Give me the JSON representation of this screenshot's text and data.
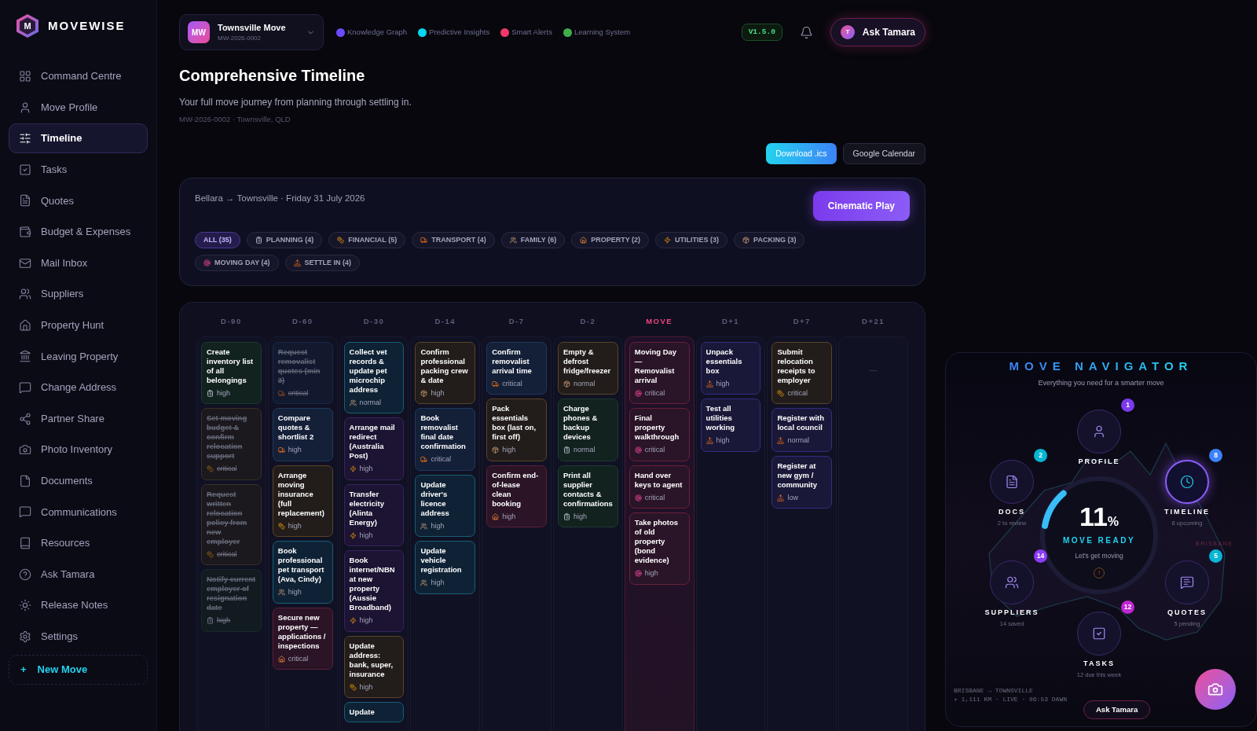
{
  "brand": {
    "logo_letter": "M",
    "name": "MOVEWISE"
  },
  "sidebar": {
    "items": [
      {
        "label": "Command Centre",
        "selected": false
      },
      {
        "label": "Move Profile",
        "selected": false
      },
      {
        "label": "Timeline",
        "selected": true
      },
      {
        "label": "Tasks",
        "selected": false
      },
      {
        "label": "Quotes",
        "selected": false
      },
      {
        "label": "Budget & Expenses",
        "selected": false
      },
      {
        "label": "Mail Inbox",
        "selected": false
      },
      {
        "label": "Suppliers",
        "selected": false
      },
      {
        "label": "Property Hunt",
        "selected": false
      },
      {
        "label": "Leaving Property",
        "selected": false
      },
      {
        "label": "Change Address",
        "selected": false
      },
      {
        "label": "Partner Share",
        "selected": false
      },
      {
        "label": "Photo Inventory",
        "selected": false
      },
      {
        "label": "Documents",
        "selected": false
      },
      {
        "label": "Communications",
        "selected": false
      },
      {
        "label": "Resources",
        "selected": false
      },
      {
        "label": "Ask Tamara",
        "selected": false
      },
      {
        "label": "Release Notes",
        "selected": false
      },
      {
        "label": "Settings",
        "selected": false
      }
    ],
    "new_button": {
      "icon": "+",
      "label": "New Move"
    }
  },
  "topbar": {
    "project": {
      "initials": "MW",
      "name": "Townsville Move",
      "id": "MW-2026-0002"
    },
    "systems": [
      {
        "label": "Knowledge Graph",
        "color": "#6d4aff"
      },
      {
        "label": "Predictive Insights",
        "color": "#06d6f0"
      },
      {
        "label": "Smart Alerts",
        "color": "#f0386b"
      },
      {
        "label": "Learning System",
        "color": "#3fae4a"
      }
    ],
    "version": "V1.5.0",
    "assistant": {
      "initial": "T",
      "label": "Ask Tamara"
    }
  },
  "page": {
    "title": "Comprehensive Timeline",
    "subtitle": "Your full move journey from planning through settling in.",
    "meta": "MW-2026-0002 · Townsville, QLD",
    "actions": [
      {
        "label": "Download .ics",
        "kind": "primary"
      },
      {
        "label": "Google Calendar",
        "kind": "secondary"
      }
    ]
  },
  "filters": {
    "route": "Bellara → Townsville · Friday 31 July 2026",
    "play_button": "Cinematic Play",
    "chips": [
      {
        "label": "ALL (35)",
        "kind": "all",
        "selected": true
      },
      {
        "label": "PLANNING (4)",
        "kind": "planning",
        "selected": false
      },
      {
        "label": "FINANCIAL (5)",
        "kind": "financial",
        "selected": false
      },
      {
        "label": "TRANSPORT (4)",
        "kind": "transport",
        "selected": false
      },
      {
        "label": "FAMILY (6)",
        "kind": "family",
        "selected": false
      },
      {
        "label": "PROPERTY (2)",
        "kind": "property",
        "selected": false
      },
      {
        "label": "UTILITIES (3)",
        "kind": "utilities",
        "selected": false
      },
      {
        "label": "PACKING (3)",
        "kind": "packing",
        "selected": false
      },
      {
        "label": "MOVING DAY (4)",
        "kind": "moving_day",
        "selected": false
      },
      {
        "label": "SETTLE IN (4)",
        "kind": "settle_in",
        "selected": false
      }
    ]
  },
  "timeline": {
    "columns": [
      {
        "label": "D-90",
        "current": false,
        "tasks": [
          {
            "title": "Create inventory list of all belongings",
            "kind": "planning",
            "priority": "high",
            "done": false
          },
          {
            "title": "Set moving budget & confirm relocation support",
            "kind": "financial",
            "priority": "critical",
            "done": true
          },
          {
            "title": "Request written relocation policy from new employer",
            "kind": "financial",
            "priority": "critical",
            "done": true
          },
          {
            "title": "Notify current employer of resignation date",
            "kind": "planning",
            "priority": "high",
            "done": true
          }
        ]
      },
      {
        "label": "D-60",
        "current": false,
        "tasks": [
          {
            "title": "Request removalist quotes (min 3)",
            "kind": "transport",
            "priority": "critical",
            "done": true
          },
          {
            "title": "Compare quotes & shortlist 2",
            "kind": "transport",
            "priority": "high",
            "done": false
          },
          {
            "title": "Arrange moving insurance (full replacement)",
            "kind": "financial",
            "priority": "high",
            "done": false
          },
          {
            "title": "Book professional pet transport (Ava, Cindy)",
            "kind": "family",
            "priority": "high",
            "done": false
          },
          {
            "title": "Secure new property — applications / inspections",
            "kind": "property",
            "priority": "critical",
            "done": false
          }
        ]
      },
      {
        "label": "D-30",
        "current": false,
        "tasks": [
          {
            "title": "Collect vet records & update pet microchip address",
            "kind": "family",
            "priority": "normal",
            "done": false
          },
          {
            "title": "Arrange mail redirect (Australia Post)",
            "kind": "utilities",
            "priority": "high",
            "done": false
          },
          {
            "title": "Transfer electricity (Alinta Energy)",
            "kind": "utilities",
            "priority": "high",
            "done": false
          },
          {
            "title": "Book internet/NBN at new property (Aussie Broadband)",
            "kind": "utilities",
            "priority": "high",
            "done": false
          },
          {
            "title": "Update address: bank, super, insurance",
            "kind": "financial",
            "priority": "high",
            "done": false
          },
          {
            "title": "Update",
            "kind": "family",
            "done": false
          }
        ]
      },
      {
        "label": "D-14",
        "current": false,
        "tasks": [
          {
            "title": "Confirm professional packing crew & date",
            "kind": "packing",
            "priority": "high",
            "done": false
          },
          {
            "title": "Book removalist final date confirmation",
            "kind": "transport",
            "priority": "critical",
            "done": false
          },
          {
            "title": "Update driver's licence address",
            "kind": "family",
            "priority": "high",
            "done": false
          },
          {
            "title": "Update vehicle registration",
            "kind": "family",
            "priority": "high",
            "done": false
          }
        ]
      },
      {
        "label": "D-7",
        "current": false,
        "tasks": [
          {
            "title": "Confirm removalist arrival time",
            "kind": "transport",
            "priority": "critical",
            "done": false
          },
          {
            "title": "Pack essentials box (last on, first off)",
            "kind": "packing",
            "priority": "high",
            "done": false
          },
          {
            "title": "Confirm end-of-lease clean booking",
            "kind": "property",
            "priority": "high",
            "done": false
          }
        ]
      },
      {
        "label": "D-2",
        "current": false,
        "tasks": [
          {
            "title": "Empty & defrost fridge/freezer",
            "kind": "packing",
            "priority": "normal",
            "done": false
          },
          {
            "title": "Charge phones & backup devices",
            "kind": "planning",
            "priority": "normal",
            "done": false
          },
          {
            "title": "Print all supplier contacts & confirmations",
            "kind": "planning",
            "priority": "high",
            "done": false
          }
        ]
      },
      {
        "label": "MOVE",
        "current": true,
        "tasks": [
          {
            "title": "Moving Day — Removalist arrival",
            "kind": "moving_day",
            "priority": "critical",
            "done": false
          },
          {
            "title": "Final property walkthrough",
            "kind": "moving_day",
            "priority": "critical",
            "done": false
          },
          {
            "title": "Hand over keys to agent",
            "kind": "moving_day",
            "priority": "critical",
            "done": false
          },
          {
            "title": "Take photos of old property (bond evidence)",
            "kind": "moving_day",
            "priority": "high",
            "done": false
          }
        ]
      },
      {
        "label": "D+1",
        "current": false,
        "tasks": [
          {
            "title": "Unpack essentials box",
            "kind": "settle_in",
            "priority": "high",
            "done": false
          },
          {
            "title": "Test all utilities working",
            "kind": "settle_in",
            "priority": "high",
            "done": false
          }
        ]
      },
      {
        "label": "D+7",
        "current": false,
        "tasks": [
          {
            "title": "Submit relocation receipts to employer",
            "kind": "financial",
            "priority": "critical",
            "done": false
          },
          {
            "title": "Register with local council",
            "kind": "settle_in",
            "priority": "normal",
            "done": false
          },
          {
            "title": "Register at new gym / community",
            "kind": "settle_in",
            "priority": "low",
            "done": false
          }
        ]
      },
      {
        "label": "D+21",
        "current": false,
        "empty_text": "—"
      }
    ]
  },
  "navigator": {
    "title": "MOVE NAVIGATOR",
    "subtitle": "Everything you need for a smarter move",
    "progress": {
      "value": "11",
      "unit": "%",
      "level": 0.11,
      "label": "MOVE READY",
      "note": "Let's get moving",
      "alert": "!"
    },
    "nodes": [
      {
        "label": "PROFILE",
        "badge": "1",
        "color": "#7c3aed",
        "selected": false
      },
      {
        "label": "DOCS",
        "sub": "2 to review",
        "badge": "2",
        "color": "#06b6d4",
        "selected": false
      },
      {
        "label": "TIMELINE",
        "sub": "8 upcoming",
        "badge": "8",
        "color": "#3b82f6",
        "selected": true
      },
      {
        "label": "SUPPLIERS",
        "sub": "14 saved",
        "badge": "14",
        "color": "#8b3cf6",
        "selected": false
      },
      {
        "label": "QUOTES",
        "sub": "5 pending",
        "badge": "5",
        "color": "#06b6d4",
        "selected": false
      },
      {
        "label": "TASKS",
        "sub": "12 due this week",
        "badge": "12",
        "color": "#c026d3",
        "selected": false
      }
    ],
    "map_label": "BRISBANE",
    "footer": {
      "route": "BRISBANE → TOWNSVILLE",
      "status": "• 1,111 KM · LIVE · 06:53 DAWN"
    },
    "ask_button": "Ask Tamara"
  }
}
